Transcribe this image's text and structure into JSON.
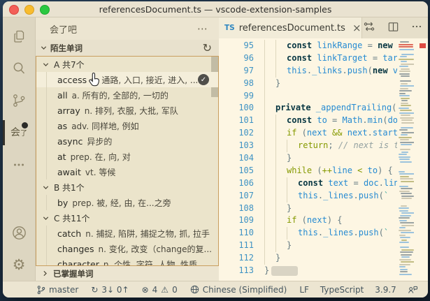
{
  "window": {
    "title": "referencesDocument.ts — vscode-extension-samples"
  },
  "activity_bar": {
    "huile_main": "会",
    "huile_sub": "了",
    "gear_glyph": "⚙",
    "more_glyph": "• • •"
  },
  "sidebar": {
    "title": "会了吧",
    "more_glyph": "⋯",
    "section_label": "陌生单词",
    "refresh_glyph": "↻",
    "collapsed_section_label": "已掌握单词",
    "check_glyph": "✓",
    "tree": {
      "rows": [
        {
          "type": "group",
          "label": "A 共7个"
        },
        {
          "type": "word",
          "word": "access",
          "def": "n. 通路, 入口, 接近, 进入, ...",
          "hovered": true,
          "checked": true
        },
        {
          "type": "word",
          "word": "all",
          "def": "a. 所有的, 全部的, 一切的"
        },
        {
          "type": "word",
          "word": "array",
          "def": "n. 排列, 衣服, 大批, 军队"
        },
        {
          "type": "word",
          "word": "as",
          "def": "adv. 同样地, 例如"
        },
        {
          "type": "word",
          "word": "async",
          "def": "异步的"
        },
        {
          "type": "word",
          "word": "at",
          "def": "prep. 在, 向, 对"
        },
        {
          "type": "word",
          "word": "await",
          "def": "vt. 等候"
        },
        {
          "type": "group",
          "label": "B 共1个"
        },
        {
          "type": "word",
          "word": "by",
          "def": "prep. 被, 经, 由, 在...之旁"
        },
        {
          "type": "group",
          "label": "C 共11个"
        },
        {
          "type": "word",
          "word": "catch",
          "def": "n. 捕捉, 陷阱, 捕捉之物, 抓, 拉手"
        },
        {
          "type": "word",
          "word": "changes",
          "def": "n. 变化, 改变（change的复..."
        },
        {
          "type": "word",
          "word": "character",
          "def": "n. 个性, 字符, 人物, 性质, ..."
        }
      ]
    }
  },
  "editor": {
    "tab": {
      "ts_badge": "TS",
      "title": "referencesDocument.ts",
      "close_glyph": "×"
    },
    "code": {
      "lines": [
        {
          "n": "95",
          "d": 2,
          "tokens": [
            [
              "k",
              "const "
            ],
            [
              "v",
              "linkRange"
            ],
            [
              "p",
              " = "
            ],
            [
              "k",
              "new"
            ],
            [
              "p",
              " "
            ]
          ]
        },
        {
          "n": "96",
          "d": 2,
          "tokens": [
            [
              "k",
              "const "
            ],
            [
              "v",
              "linkTarget"
            ],
            [
              "p",
              " = "
            ],
            [
              "v",
              "tar"
            ]
          ]
        },
        {
          "n": "97",
          "d": 2,
          "tokens": [
            [
              "v",
              "this"
            ],
            [
              "p",
              "."
            ],
            [
              "v",
              "_links"
            ],
            [
              "p",
              "."
            ],
            [
              "v",
              "push"
            ],
            [
              "p",
              "("
            ],
            [
              "k",
              "new"
            ],
            [
              "p",
              " "
            ],
            [
              "v",
              "v"
            ]
          ]
        },
        {
          "n": "98",
          "d": 1,
          "tokens": [
            [
              "p",
              "}"
            ]
          ]
        },
        {
          "n": "99",
          "d": 1,
          "tokens": []
        },
        {
          "n": "100",
          "d": 1,
          "tokens": [
            [
              "k",
              "private "
            ],
            [
              "v",
              "_appendTrailing"
            ],
            [
              "p",
              "("
            ]
          ]
        },
        {
          "n": "101",
          "d": 2,
          "tokens": [
            [
              "k",
              "const "
            ],
            [
              "v",
              "to"
            ],
            [
              "p",
              " = "
            ],
            [
              "v",
              "Math"
            ],
            [
              "p",
              "."
            ],
            [
              "v",
              "min"
            ],
            [
              "p",
              "("
            ],
            [
              "v",
              "do"
            ]
          ]
        },
        {
          "n": "102",
          "d": 2,
          "tokens": [
            [
              "c",
              "if"
            ],
            [
              "p",
              " ("
            ],
            [
              "v",
              "next"
            ],
            [
              "p",
              " "
            ],
            [
              "o",
              "&&"
            ],
            [
              "p",
              " "
            ],
            [
              "v",
              "next"
            ],
            [
              "p",
              "."
            ],
            [
              "v",
              "start"
            ]
          ]
        },
        {
          "n": "103",
          "d": 3,
          "tokens": [
            [
              "c",
              "return"
            ],
            [
              "p",
              "; "
            ],
            [
              "m",
              "// next is t"
            ]
          ]
        },
        {
          "n": "104",
          "d": 2,
          "tokens": [
            [
              "p",
              "}"
            ]
          ]
        },
        {
          "n": "105",
          "d": 2,
          "tokens": [
            [
              "c",
              "while"
            ],
            [
              "p",
              " ("
            ],
            [
              "o",
              "++"
            ],
            [
              "v",
              "line"
            ],
            [
              "p",
              " "
            ],
            [
              "o",
              "<"
            ],
            [
              "p",
              " "
            ],
            [
              "v",
              "to"
            ],
            [
              "p",
              ") {"
            ]
          ]
        },
        {
          "n": "106",
          "d": 3,
          "tokens": [
            [
              "k",
              "const "
            ],
            [
              "v",
              "text"
            ],
            [
              "p",
              " = "
            ],
            [
              "v",
              "doc"
            ],
            [
              "p",
              "."
            ],
            [
              "v",
              "lin"
            ]
          ]
        },
        {
          "n": "107",
          "d": 3,
          "tokens": [
            [
              "v",
              "this"
            ],
            [
              "p",
              "."
            ],
            [
              "v",
              "_lines"
            ],
            [
              "p",
              "."
            ],
            [
              "v",
              "push"
            ],
            [
              "p",
              "("
            ],
            [
              "s",
              "`"
            ]
          ]
        },
        {
          "n": "108",
          "d": 2,
          "tokens": [
            [
              "p",
              "}"
            ]
          ]
        },
        {
          "n": "109",
          "d": 2,
          "tokens": [
            [
              "c",
              "if"
            ],
            [
              "p",
              " ("
            ],
            [
              "v",
              "next"
            ],
            [
              "p",
              ") {"
            ]
          ]
        },
        {
          "n": "110",
          "d": 3,
          "tokens": [
            [
              "v",
              "this"
            ],
            [
              "p",
              "."
            ],
            [
              "v",
              "_lines"
            ],
            [
              "p",
              "."
            ],
            [
              "v",
              "push"
            ],
            [
              "p",
              "("
            ],
            [
              "s",
              "`"
            ]
          ]
        },
        {
          "n": "111",
          "d": 2,
          "tokens": [
            [
              "p",
              "}"
            ]
          ]
        },
        {
          "n": "112",
          "d": 1,
          "tokens": [
            [
              "p",
              "}"
            ]
          ]
        },
        {
          "n": "113",
          "d": 0,
          "tokens": [
            [
              "p",
              "}"
            ]
          ],
          "sel": true
        }
      ]
    }
  },
  "status_bar": {
    "branch": "master",
    "sync": "3↓ 0↑",
    "sync_glyph": "↻",
    "error_glyph": "⊗",
    "errors": "4",
    "warning_glyph": "⚠",
    "warnings": "0",
    "language_status": "Chinese (Simplified)",
    "eol": "LF",
    "language": "TypeScript",
    "ts_version": "3.9.7"
  },
  "colors": {
    "editor_bg": "#fdf6e3",
    "sidebar_bg": "#ece5d1",
    "activitybar_bg": "#ddd6c1",
    "focus_border": "#c99e5f",
    "error_marker": "#dd4b42",
    "keyword": "#073642",
    "control": "#859900",
    "identifier": "#268bd2",
    "comment": "#93a1a1",
    "string": "#2aa198"
  }
}
